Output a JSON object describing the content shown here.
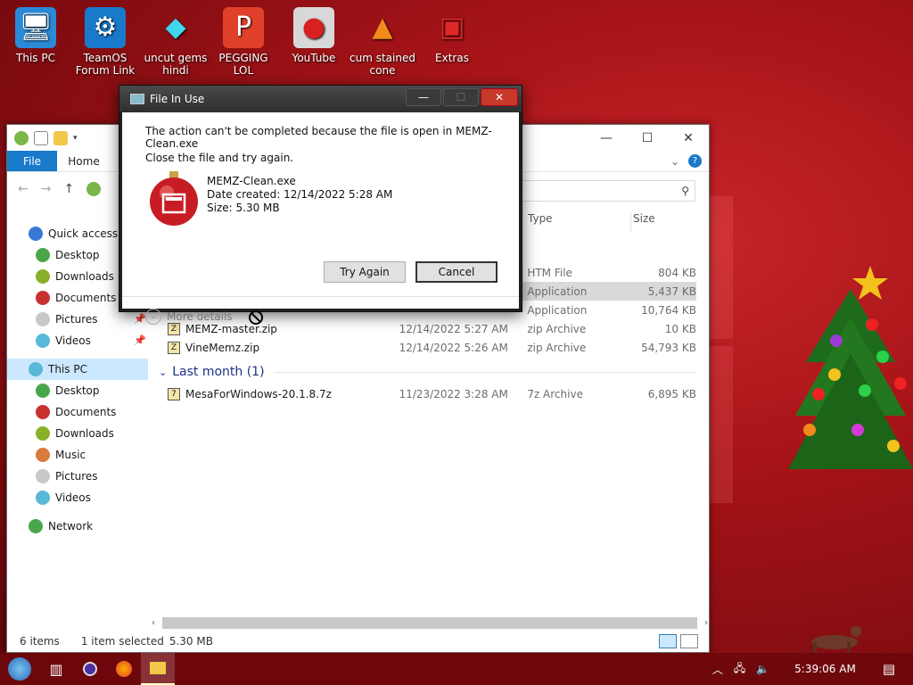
{
  "desktop": {
    "icons": [
      {
        "label": "This PC",
        "icon": "monitor-icon"
      },
      {
        "label": "TeamOS Forum Link",
        "icon": "gear-icon"
      },
      {
        "label": "uncut gems hindi",
        "icon": "diamond-icon"
      },
      {
        "label": "PEGGING LOL",
        "icon": "letter-p-icon"
      },
      {
        "label": "YouTube",
        "icon": "angry-bird-icon"
      },
      {
        "label": "cum stained cone",
        "icon": "traffic-cone-icon"
      },
      {
        "label": "Extras",
        "icon": "gift-box-icon"
      }
    ]
  },
  "explorer": {
    "ribbon": {
      "file": "File",
      "home": "Home"
    },
    "sidebar": [
      {
        "label": "Quick access",
        "level": "top",
        "color": "#3a78d8"
      },
      {
        "label": "Desktop",
        "level": "sub",
        "color": "#4aa64a",
        "pinned": true
      },
      {
        "label": "Downloads",
        "level": "sub",
        "color": "#8ab02a",
        "pinned": true
      },
      {
        "label": "Documents",
        "level": "sub",
        "color": "#c93030",
        "pinned": true
      },
      {
        "label": "Pictures",
        "level": "sub",
        "color": "#c8c8c8",
        "pinned": true
      },
      {
        "label": "Videos",
        "level": "sub",
        "color": "#58b8d8",
        "pinned": true
      },
      {
        "label": "This PC",
        "level": "top",
        "color": "#58b8d8",
        "selected": true
      },
      {
        "label": "Desktop",
        "level": "sub",
        "color": "#4aa64a"
      },
      {
        "label": "Documents",
        "level": "sub",
        "color": "#c93030"
      },
      {
        "label": "Downloads",
        "level": "sub",
        "color": "#8ab02a"
      },
      {
        "label": "Music",
        "level": "sub",
        "color": "#d87a3a"
      },
      {
        "label": "Pictures",
        "level": "sub",
        "color": "#c8c8c8"
      },
      {
        "label": "Videos",
        "level": "sub",
        "color": "#58b8d8"
      },
      {
        "label": "Network",
        "level": "top",
        "color": "#4aa64a"
      }
    ],
    "columns": {
      "type": "Type",
      "size": "Size"
    },
    "partial_rows": [
      {
        "type": "HTM File",
        "size": "804 KB",
        "selected": false
      },
      {
        "type": "Application",
        "size": "5,437 KB",
        "selected": true
      },
      {
        "type": "Application",
        "size": "10,764 KB",
        "selected": false
      }
    ],
    "rows": [
      {
        "name": "MEMZ-master.zip",
        "date": "12/14/2022 5:27 AM",
        "type": "zip Archive",
        "size": "10 KB"
      },
      {
        "name": "VineMemz.zip",
        "date": "12/14/2022 5:26 AM",
        "type": "zip Archive",
        "size": "54,793 KB"
      }
    ],
    "group": {
      "label": "Last month (1)"
    },
    "group_rows": [
      {
        "name": "MesaForWindows-20.1.8.7z",
        "date": "11/23/2022 3:28 AM",
        "type": "7z Archive",
        "size": "6,895 KB"
      }
    ],
    "status": {
      "items": "6 items",
      "selected": "1 item selected",
      "size": "5.30 MB"
    }
  },
  "dialog": {
    "title": "File In Use",
    "message": "The action can't be completed because the file is open in MEMZ-Clean.exe",
    "instruction": "Close the file and try again.",
    "file_name": "MEMZ-Clean.exe",
    "date_created": "Date created: 12/14/2022 5:28 AM",
    "size": "Size: 5.30 MB",
    "try_again": "Try Again",
    "cancel": "Cancel",
    "more_details": "More details"
  },
  "taskbar": {
    "time": "5:39:06 AM"
  }
}
